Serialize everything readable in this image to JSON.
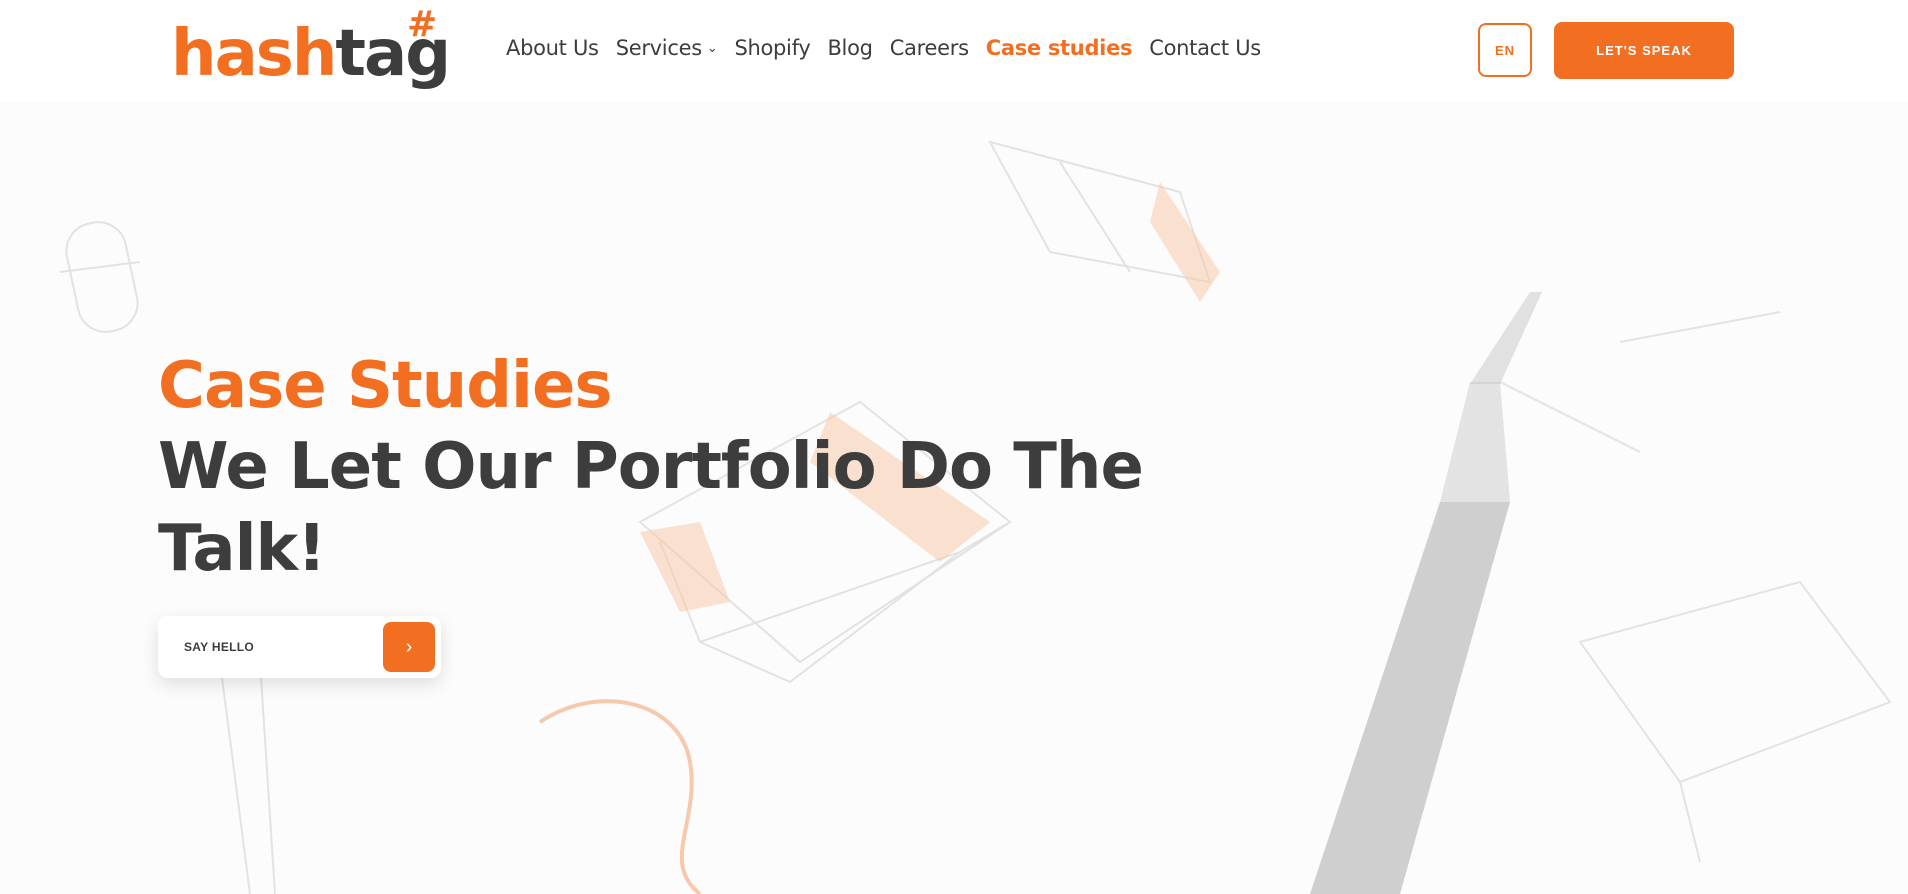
{
  "brand": {
    "logo_part1": "hash",
    "logo_part2": "tag",
    "logo_mark": "#",
    "accent_color": "#f26f21",
    "text_color": "#3d3d3d"
  },
  "nav": {
    "items": [
      {
        "label": "About Us"
      },
      {
        "label": "Services",
        "icon": "chevron-down-icon"
      },
      {
        "label": "Shopify"
      },
      {
        "label": "Blog"
      },
      {
        "label": "Careers"
      },
      {
        "label": "Case studies",
        "active": true
      },
      {
        "label": "Contact Us"
      }
    ],
    "chevron": "⌄"
  },
  "header": {
    "lang_label": "EN",
    "cta_label": "LET'S SPEAK"
  },
  "hero": {
    "kicker": "Case Studies",
    "title": "We Let Our Portfolio Do The Talk!",
    "button_label": "SAY HELLO",
    "button_icon": "chevron-right-icon",
    "button_arrow": "›"
  }
}
